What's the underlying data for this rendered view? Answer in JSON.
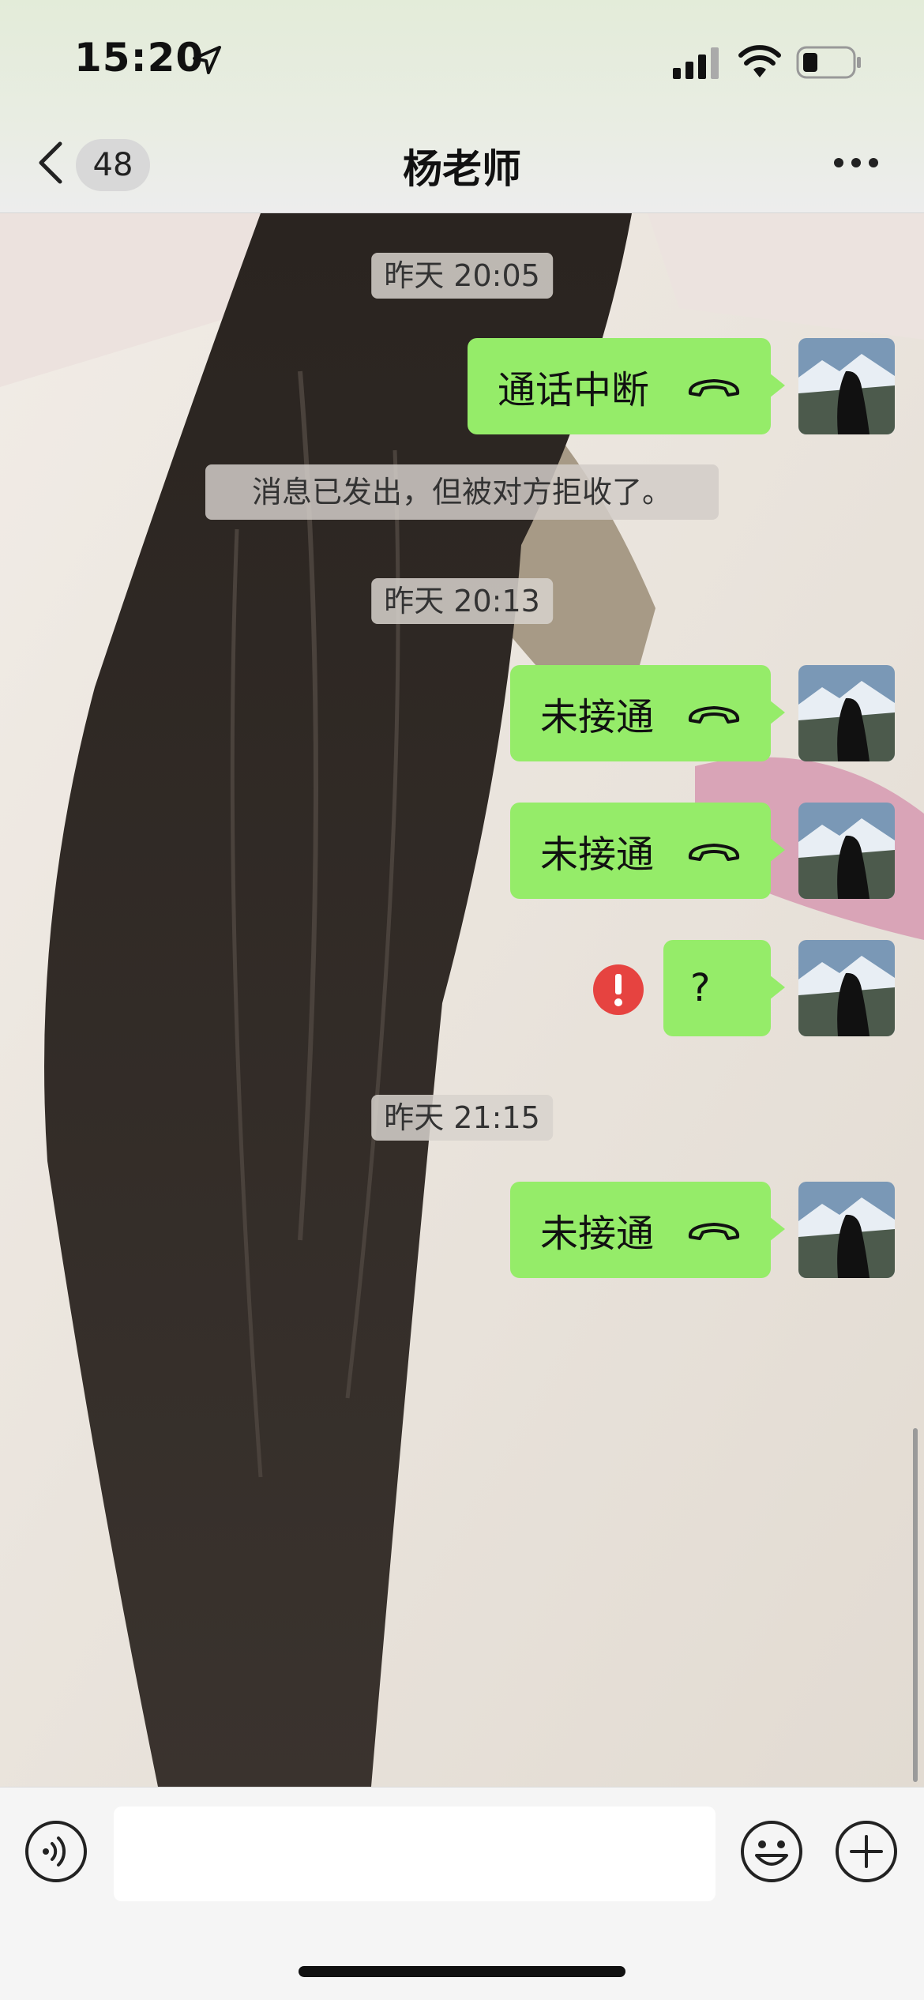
{
  "status_bar": {
    "time": "15:20"
  },
  "nav": {
    "unread_count": "48",
    "title": "杨老师"
  },
  "messages": [
    {
      "type": "timestamp",
      "text": "昨天 20:05"
    },
    {
      "type": "call",
      "text": "通话中断"
    },
    {
      "type": "system",
      "text": "消息已发出，但被对方拒收了。"
    },
    {
      "type": "timestamp",
      "text": "昨天 20:13"
    },
    {
      "type": "call",
      "text": "未接通"
    },
    {
      "type": "call",
      "text": "未接通"
    },
    {
      "type": "text",
      "text": "?",
      "failed": true
    },
    {
      "type": "timestamp",
      "text": "昨天 21:15"
    },
    {
      "type": "call",
      "text": "未接通"
    }
  ],
  "input": {
    "value": ""
  },
  "colors": {
    "bubble": "#95ec69",
    "error": "#e64340"
  },
  "icons": [
    "location-arrow-icon",
    "cellular-signal-icon",
    "wifi-icon",
    "battery-icon",
    "back-chevron-icon",
    "more-icon",
    "phone-hangup-icon",
    "error-icon",
    "voice-icon",
    "emoji-icon",
    "plus-icon"
  ]
}
